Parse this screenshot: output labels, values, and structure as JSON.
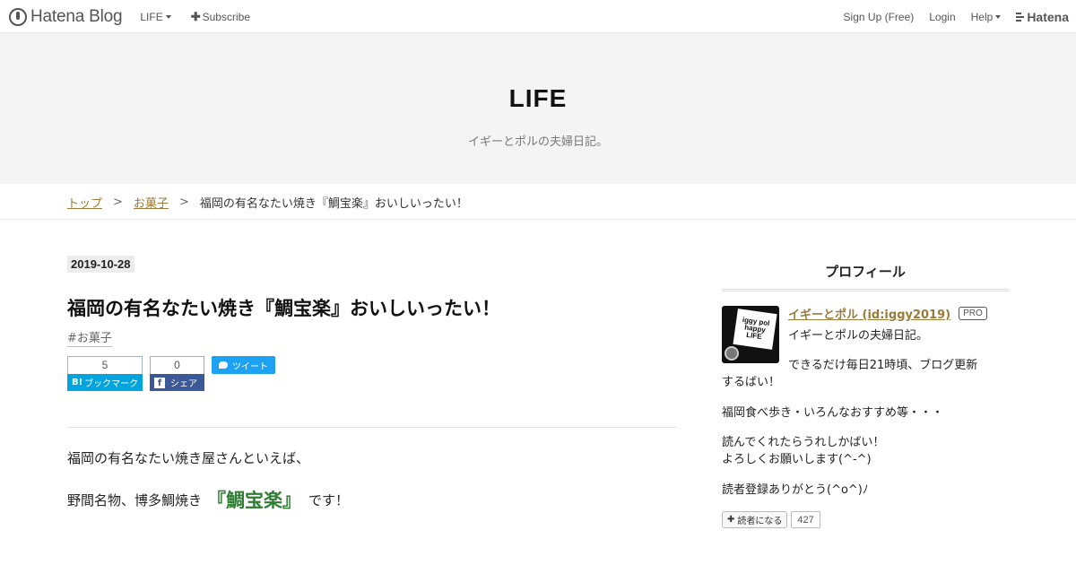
{
  "global_header": {
    "logo_text": "Hatena Blog",
    "blog_menu_label": "LIFE",
    "subscribe_label": "Subscribe",
    "signup_label": "Sign Up (Free)",
    "login_label": "Login",
    "help_label": "Help",
    "hatena_label": "Hatena"
  },
  "blog": {
    "title": "LIFE",
    "description": "イギーとポルの夫婦日記。"
  },
  "breadcrumb": {
    "top": "トップ",
    "separator": ">",
    "category": "お菓子",
    "current": "福岡の有名なたい焼き『鯛宝楽』おいしいったい！"
  },
  "entry": {
    "date": "2019-10-28",
    "title": "福岡の有名なたい焼き『鯛宝楽』おいしいったい！",
    "category_tag": "#お菓子",
    "share": {
      "hatebu_count": "5",
      "hatebu_label": "ブックマーク",
      "facebook_count": "0",
      "facebook_label": "シェア",
      "tweet_label": "ツイート"
    },
    "paragraph1": "福岡の有名なたい焼き屋さんといえば、",
    "paragraph2_before": "野間名物、博多鯛焼き",
    "paragraph2_highlight": "『鯛宝楽』",
    "paragraph2_after": "です！",
    "highlight_color": "#2e7d32"
  },
  "sidebar": {
    "heading": "プロフィール",
    "profile_name": "イギーとポル (id:iggy2019)",
    "pro_badge": "PRO",
    "avatar_lines": [
      "iggy pol",
      "happy",
      "LIFE"
    ],
    "bio1": "イギーとポルの夫婦日記。",
    "bio2_line1": "できるだけ毎日21時頃、ブログ更新",
    "bio2_line2": "するばい！",
    "bio3": "福岡食べ歩き・いろんなおすすめ等・・・",
    "bio4_line1": "読んでくれたらうれしかばい！",
    "bio4_line2": "よろしくお願いします(^-^)",
    "bio5": "読者登録ありがとう(^o^)ﾉ",
    "reader_button": "読者になる",
    "reader_count": "427"
  },
  "colors": {
    "link": "#9a7b3a",
    "hatebu": "#00a4de",
    "facebook": "#3b5998",
    "twitter": "#1da1f2"
  }
}
